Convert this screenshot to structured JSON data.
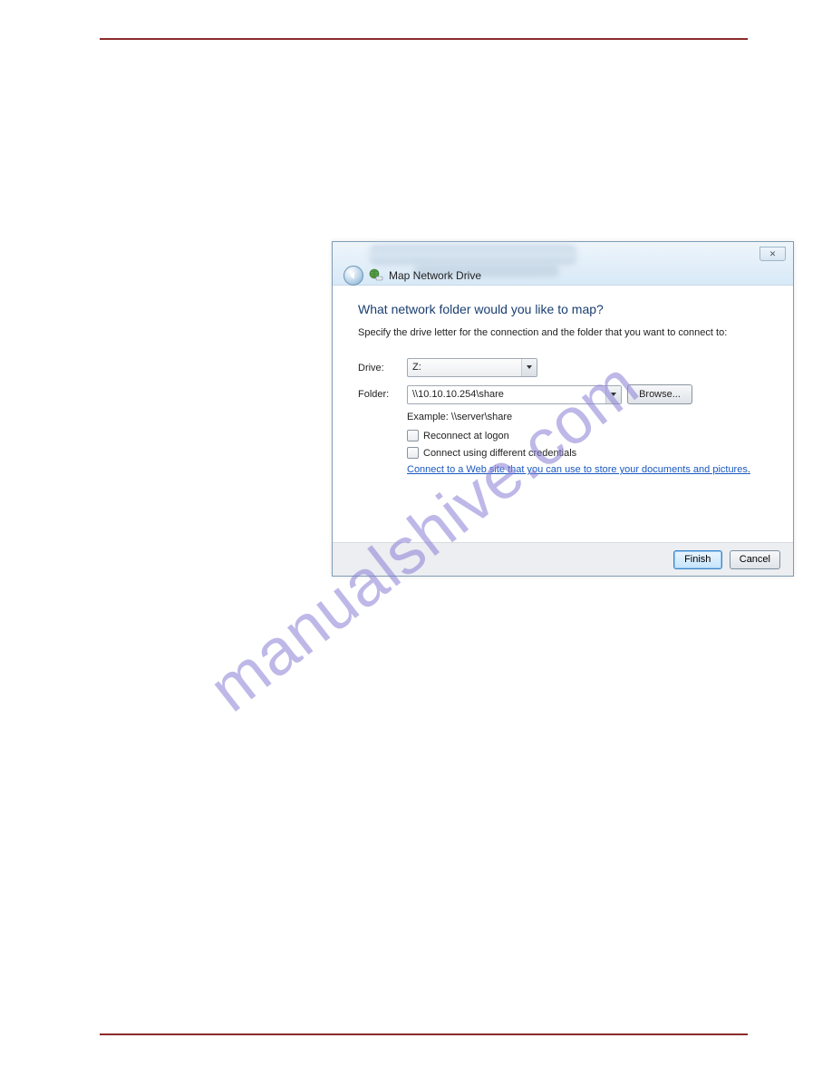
{
  "watermark": "manualshive.com",
  "dialog": {
    "title": "Map Network Drive",
    "closeGlyph": "✕",
    "heading": "What network folder would you like to map?",
    "instruction": "Specify the drive letter for the connection and the folder that you want to connect to:",
    "driveLabel": "Drive:",
    "driveValue": "Z:",
    "folderLabel": "Folder:",
    "folderValue": "\\\\10.10.10.254\\share",
    "browseLabel": "Browse...",
    "exampleText": "Example: \\\\server\\share",
    "reconnectLabel": "Reconnect at logon",
    "credentialsLabel": "Connect using different credentials",
    "linkText": "Connect to a Web site that you can use to store your documents and pictures",
    "finishLabel": "Finish",
    "cancelLabel": "Cancel"
  }
}
